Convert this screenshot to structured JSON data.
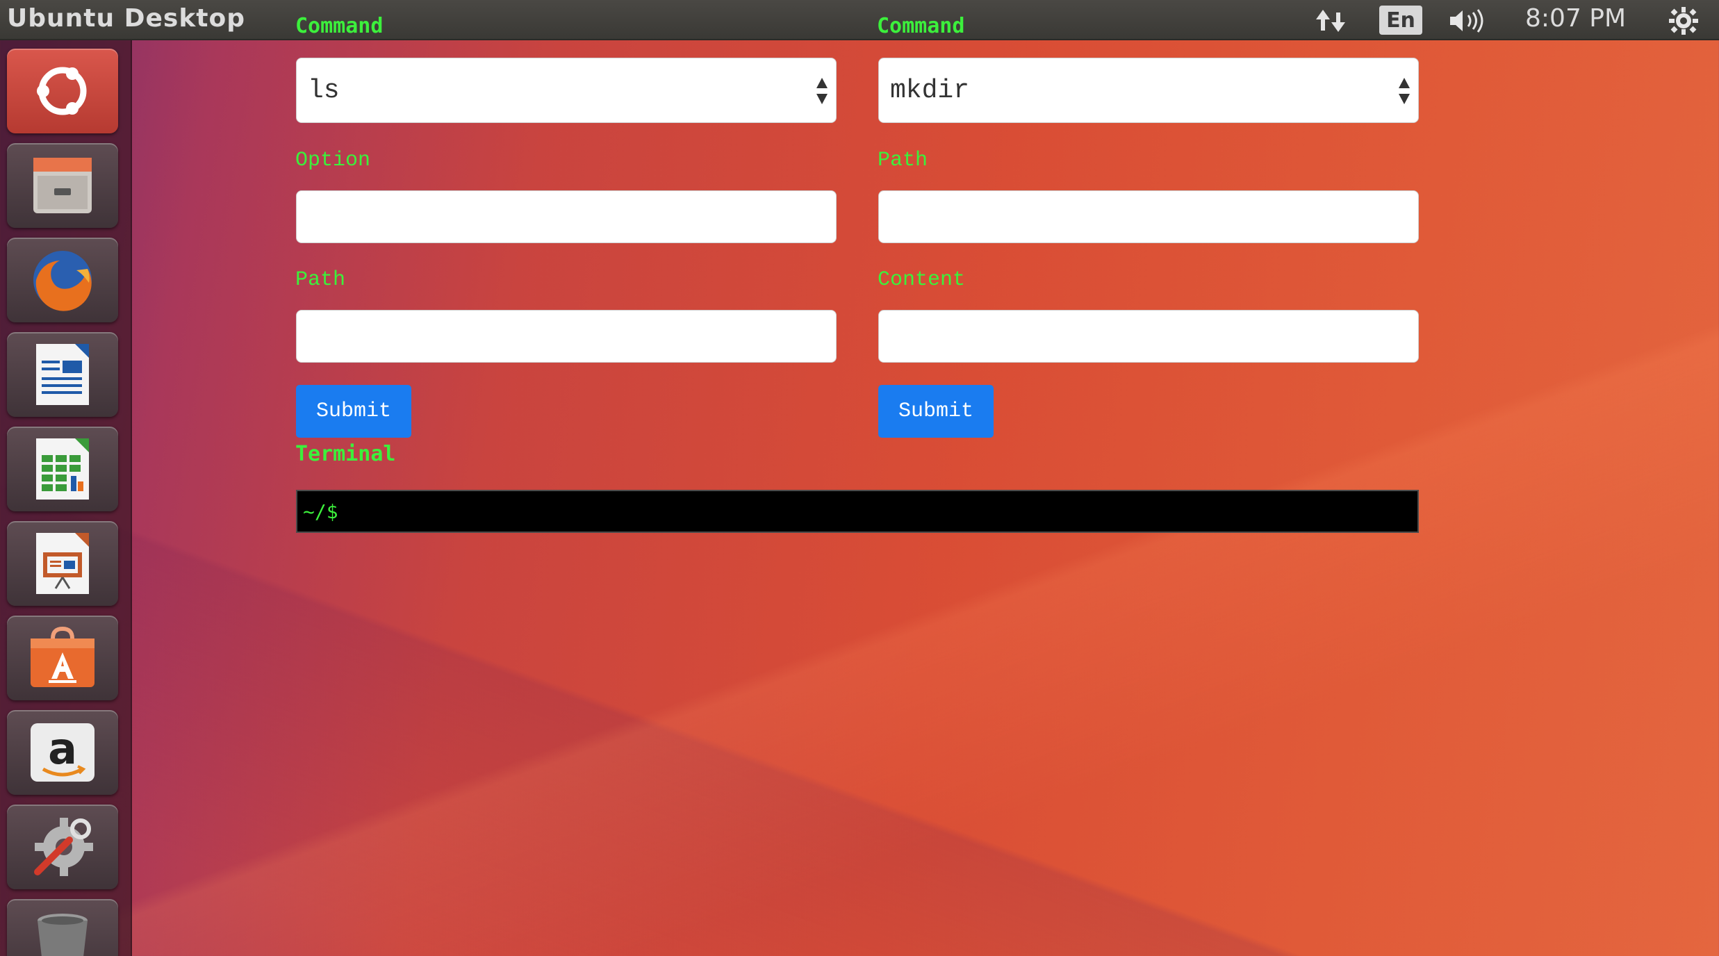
{
  "topbar": {
    "title": "Ubuntu Desktop",
    "language": "En",
    "time": "8:07 PM",
    "icons": [
      "network-icon",
      "volume-icon",
      "settings-gear-icon"
    ]
  },
  "launcher": {
    "items": [
      {
        "name": "ubuntu-dash-icon",
        "color": "#d7443b"
      },
      {
        "name": "files-icon",
        "color": "#b9b3ad"
      },
      {
        "name": "firefox-icon",
        "color": "#e26a1d"
      },
      {
        "name": "writer-icon",
        "color": "#1f5aa8"
      },
      {
        "name": "calc-icon",
        "color": "#3a9b3a"
      },
      {
        "name": "impress-icon",
        "color": "#c25a2a"
      },
      {
        "name": "software-center-icon",
        "color": "#e86a2e"
      },
      {
        "name": "amazon-icon",
        "color": "#e9e9e9"
      },
      {
        "name": "system-settings-icon",
        "color": "#9a9a9a"
      },
      {
        "name": "trash-icon",
        "color": "#7a7a7a"
      }
    ]
  },
  "form_left": {
    "command_label": "Command",
    "command_value": "ls",
    "field1_label": "Option",
    "field1_value": "",
    "field2_label": "Path",
    "field2_value": "",
    "submit_label": "Submit"
  },
  "form_right": {
    "command_label": "Command",
    "command_value": "mkdir",
    "field1_label": "Path",
    "field1_value": "",
    "field2_label": "Content",
    "field2_value": "",
    "submit_label": "Submit"
  },
  "terminal": {
    "label": "Terminal",
    "prompt": "~/$"
  },
  "colors": {
    "accent_green": "#3cf03c",
    "button_blue": "#1a7cf0"
  }
}
